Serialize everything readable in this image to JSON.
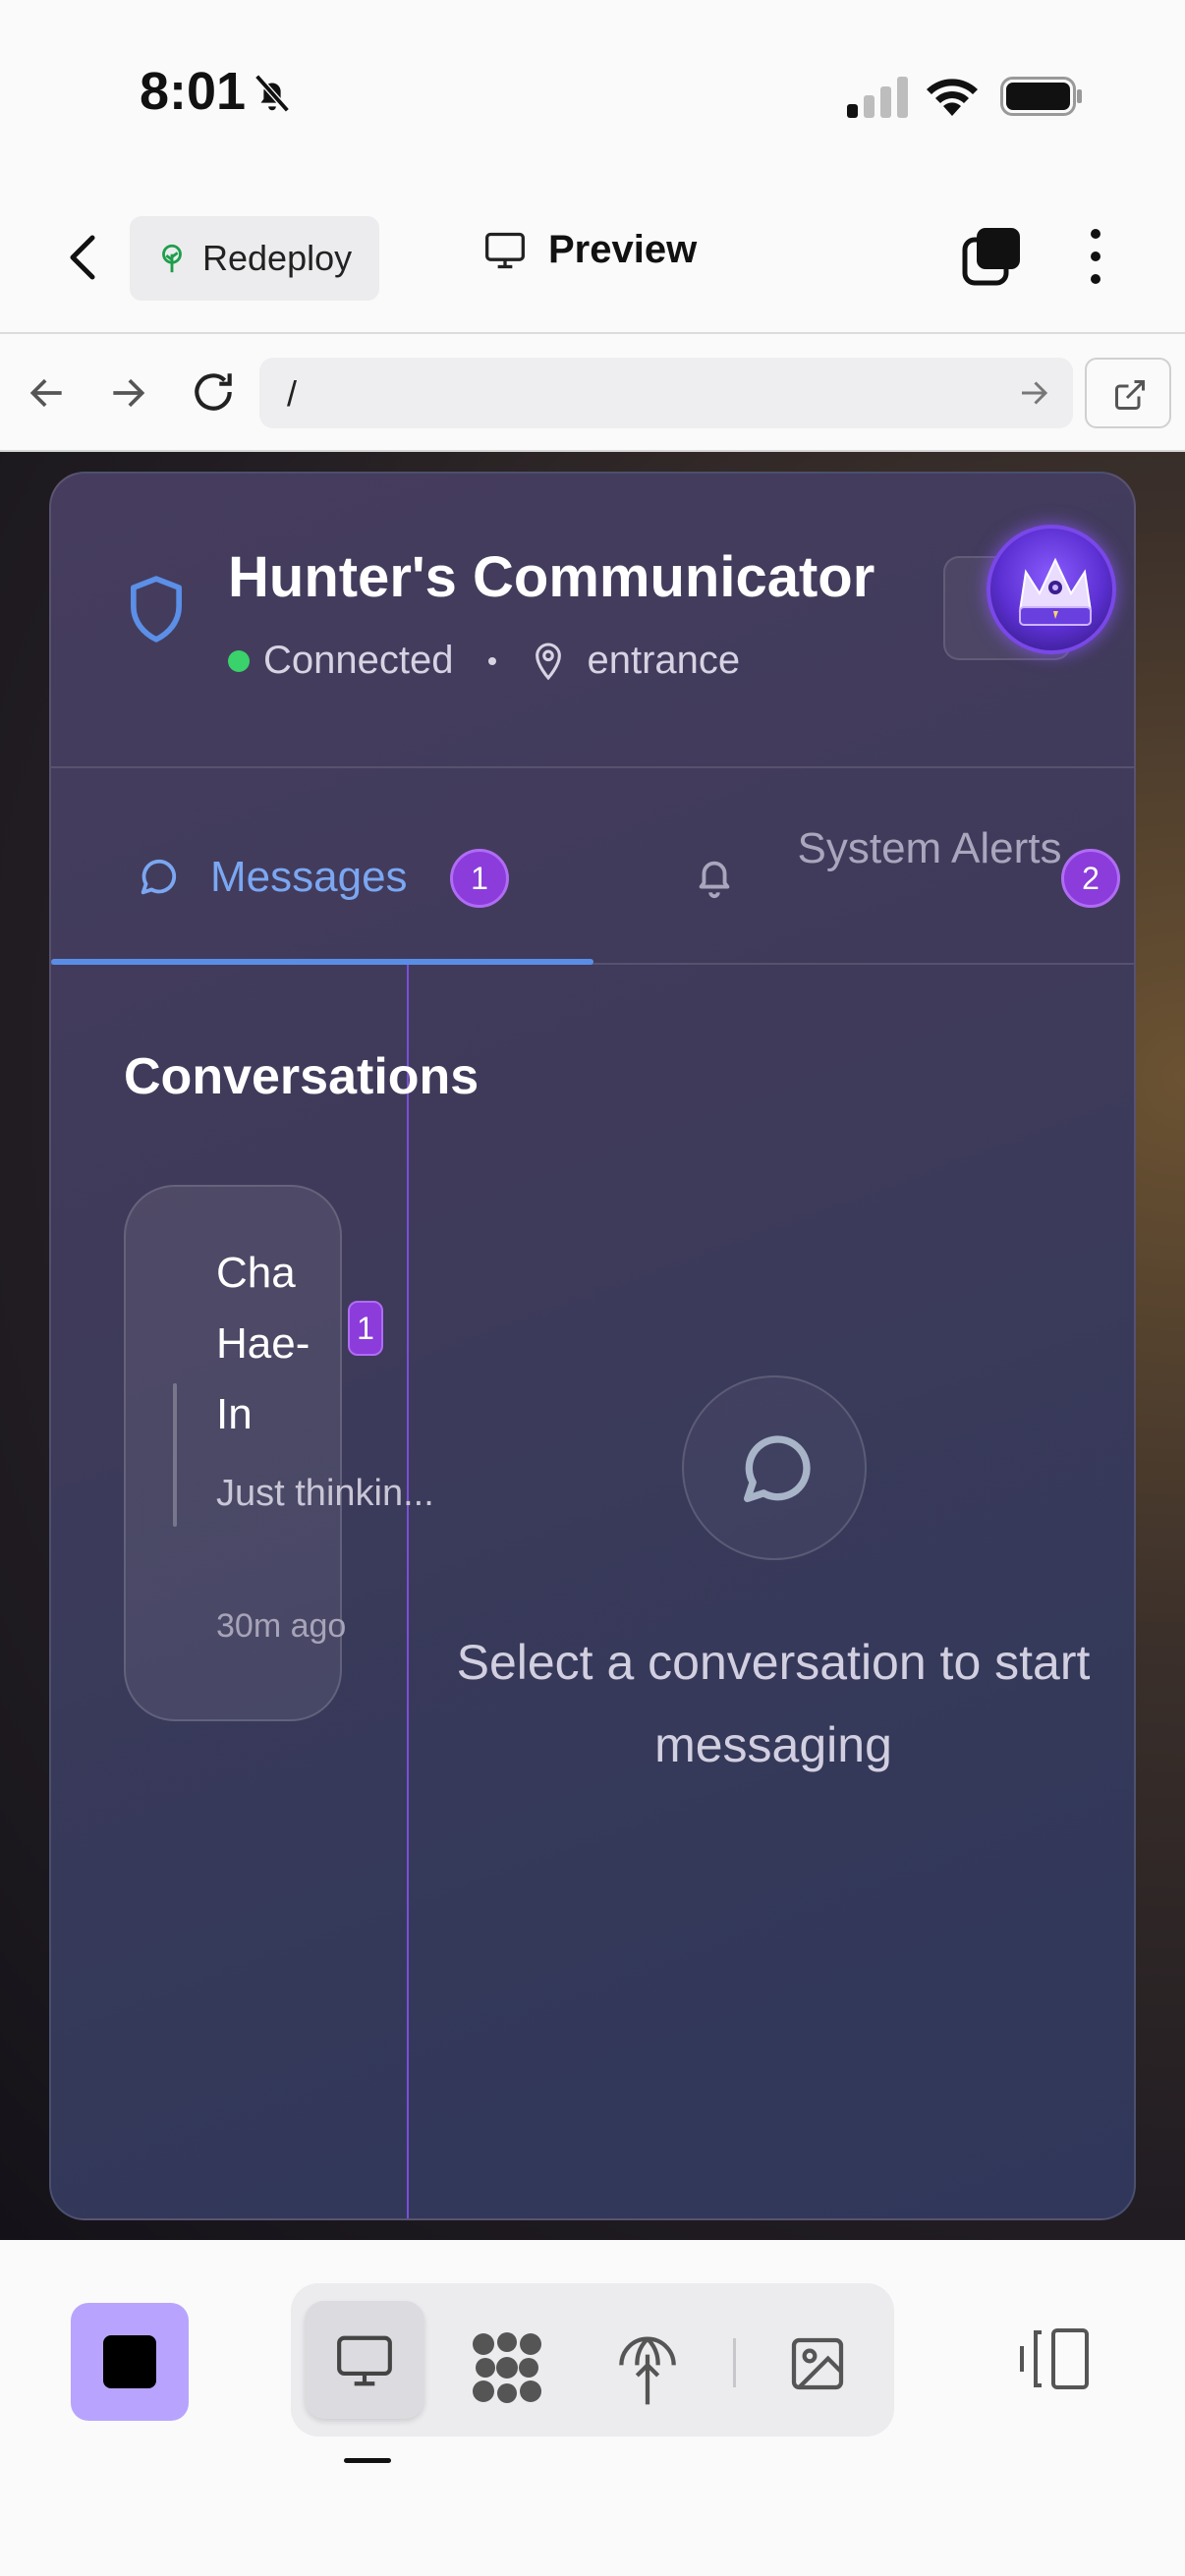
{
  "status_bar": {
    "time": "8:01",
    "icons": [
      "bell-off-icon",
      "cellular-signal-icon",
      "wifi-icon",
      "battery-icon"
    ]
  },
  "toolbar": {
    "redeploy_label": "Redeploy",
    "preview_label": "Preview"
  },
  "url_bar": {
    "url": "/"
  },
  "app": {
    "title": "Hunter's Communicator",
    "connection_status": "Connected",
    "location": "entrance",
    "colors": {
      "accent_blue": "#7ba7f2",
      "badge_purple": "#8b3cdb",
      "status_green": "#39d26b",
      "divider_purple": "#7a4fd8"
    }
  },
  "tabs": [
    {
      "label": "Messages",
      "badge": "1",
      "icon": "message-icon",
      "active": true
    },
    {
      "label": "System Alerts",
      "badge": "2",
      "icon": "bell-icon",
      "active": false
    }
  ],
  "conversations": {
    "title": "Conversations",
    "items": [
      {
        "name": "Cha Hae-In",
        "preview": "Just thinkin...",
        "time": "30m ago",
        "unread": "1"
      }
    ]
  },
  "empty_state": {
    "text": "Select a conversation to start messaging"
  },
  "bottom_bar": {
    "active_mode": "desktop",
    "modes": [
      "desktop-icon",
      "nodes-icon",
      "deploy-icon",
      "image-icon"
    ]
  }
}
